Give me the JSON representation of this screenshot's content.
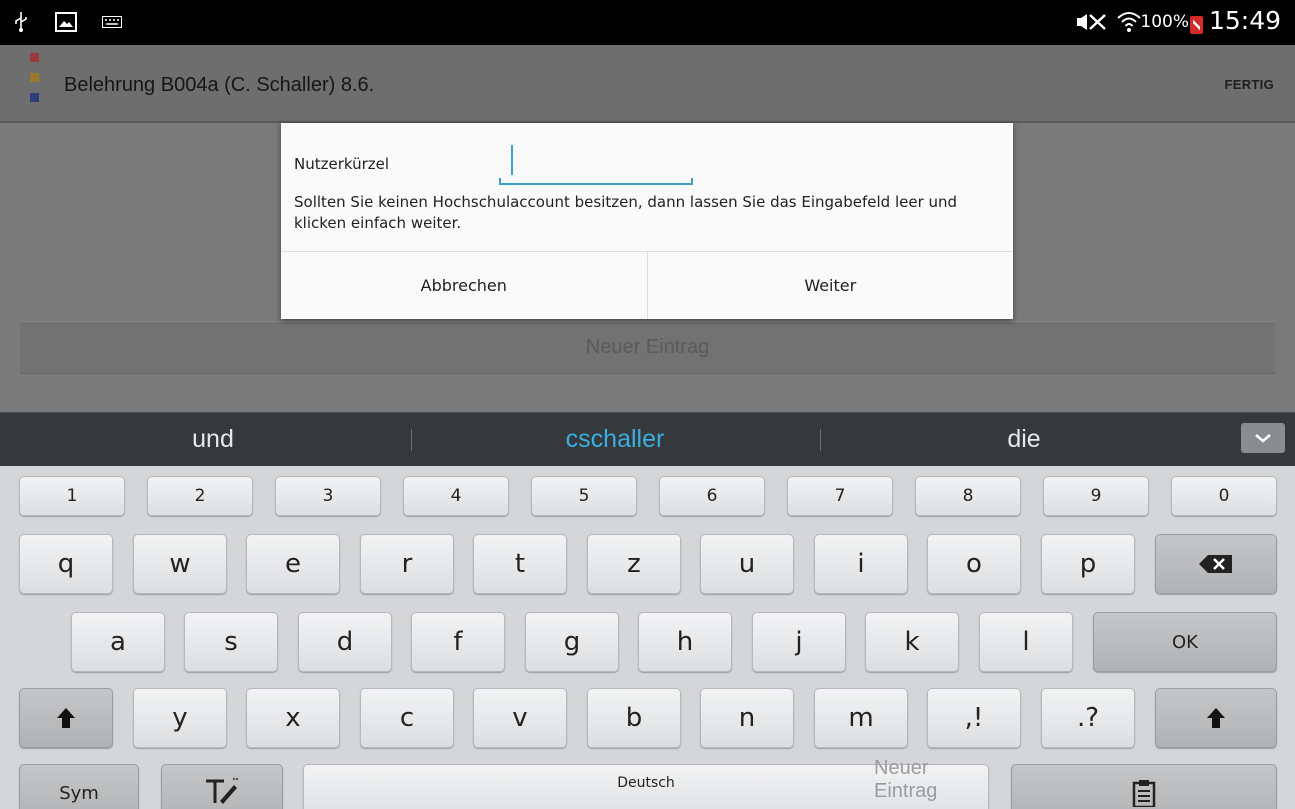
{
  "status_bar": {
    "icons": [
      "usb-icon",
      "image-icon",
      "keyboard-icon",
      "mute-icon",
      "wifi-icon"
    ],
    "battery_percent": "100%",
    "time": "15:49"
  },
  "app_bar": {
    "title": "Belehrung B004a (C. Schaller) 8.6.",
    "action_label": "FERTIG",
    "logo_colors": [
      "#b03030",
      "#b08a1a",
      "#2a4a9a"
    ]
  },
  "content": {
    "list_item_label": "Neuer Eintrag"
  },
  "dialog": {
    "field_label": "Nutzerkürzel",
    "field_value": "",
    "message": "Sollten Sie keinen Hochschulaccount besitzen, dann lassen Sie das Eingabefeld leer und klicken einfach weiter.",
    "cancel_label": "Abbrechen",
    "continue_label": "Weiter"
  },
  "suggestions": {
    "items": [
      "und",
      "cschaller",
      "die"
    ],
    "active_index": 1,
    "accent_color": "#3aaee0"
  },
  "keyboard": {
    "number_row": [
      "1",
      "2",
      "3",
      "4",
      "5",
      "6",
      "7",
      "8",
      "9",
      "0"
    ],
    "row1": [
      "q",
      "w",
      "e",
      "r",
      "t",
      "z",
      "u",
      "i",
      "o",
      "p"
    ],
    "row2": [
      "a",
      "s",
      "d",
      "f",
      "g",
      "h",
      "j",
      "k",
      "l"
    ],
    "ok_label": "OK",
    "row3": [
      "y",
      "x",
      "c",
      "v",
      "b",
      "n",
      "m"
    ],
    "punct1": ",!",
    "punct2": ".?",
    "sym_label": "Sym",
    "space_label": "Deutsch",
    "space_ghost": "Neuer Eintrag"
  }
}
